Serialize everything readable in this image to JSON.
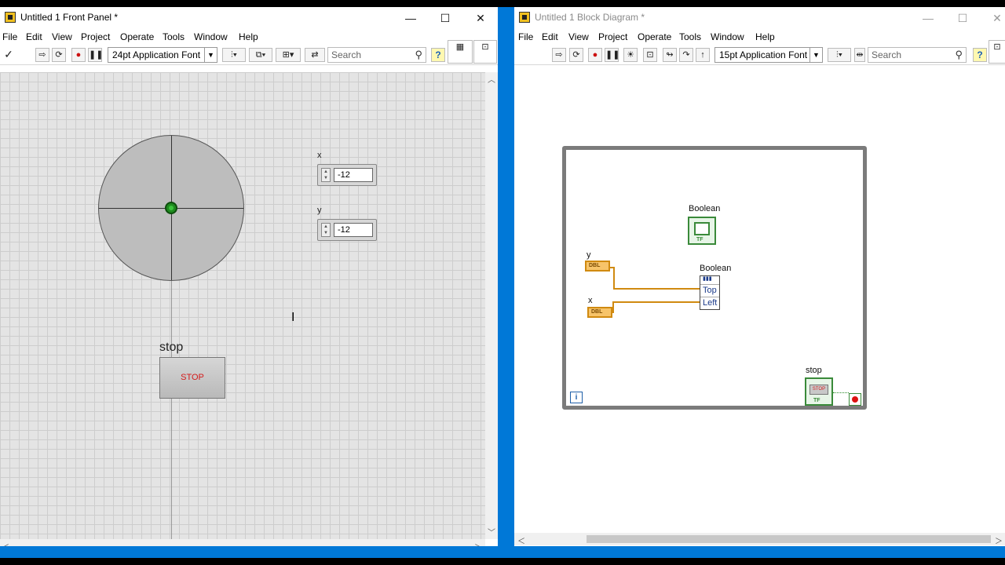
{
  "front_panel": {
    "title": "Untitled 1 Front Panel *",
    "menu": [
      "File",
      "Edit",
      "View",
      "Project",
      "Operate",
      "Tools",
      "Window",
      "Help"
    ],
    "font": "24pt Application Font",
    "search_placeholder": "Search",
    "x_label": "x",
    "x_value": "-12",
    "y_label": "y",
    "y_value": "-12",
    "stop_label": "stop",
    "stop_text": "STOP"
  },
  "block_diagram": {
    "title": "Untitled 1 Block Diagram *",
    "menu": [
      "File",
      "Edit",
      "View",
      "Project",
      "Operate",
      "Tools",
      "Window",
      "Help"
    ],
    "font": "15pt Application Font",
    "search_placeholder": "Search",
    "boolean_label": "Boolean",
    "prop_node_label": "Boolean",
    "prop_top": "Top",
    "prop_left": "Left",
    "y_label": "y",
    "x_label": "x",
    "dbl_text": "DBL",
    "stop_label": "stop",
    "stop_text": "STOP",
    "tf_text": "TF",
    "iteration_text": "i"
  },
  "window_controls": {
    "minimize": "—",
    "maximize": "☐",
    "close": "✕"
  },
  "colors": {
    "desktop": "#0078d7",
    "stop_text": "#d41b1b",
    "numeric_wire": "#d08a10",
    "boolean_wire": "#3a8a3a"
  }
}
